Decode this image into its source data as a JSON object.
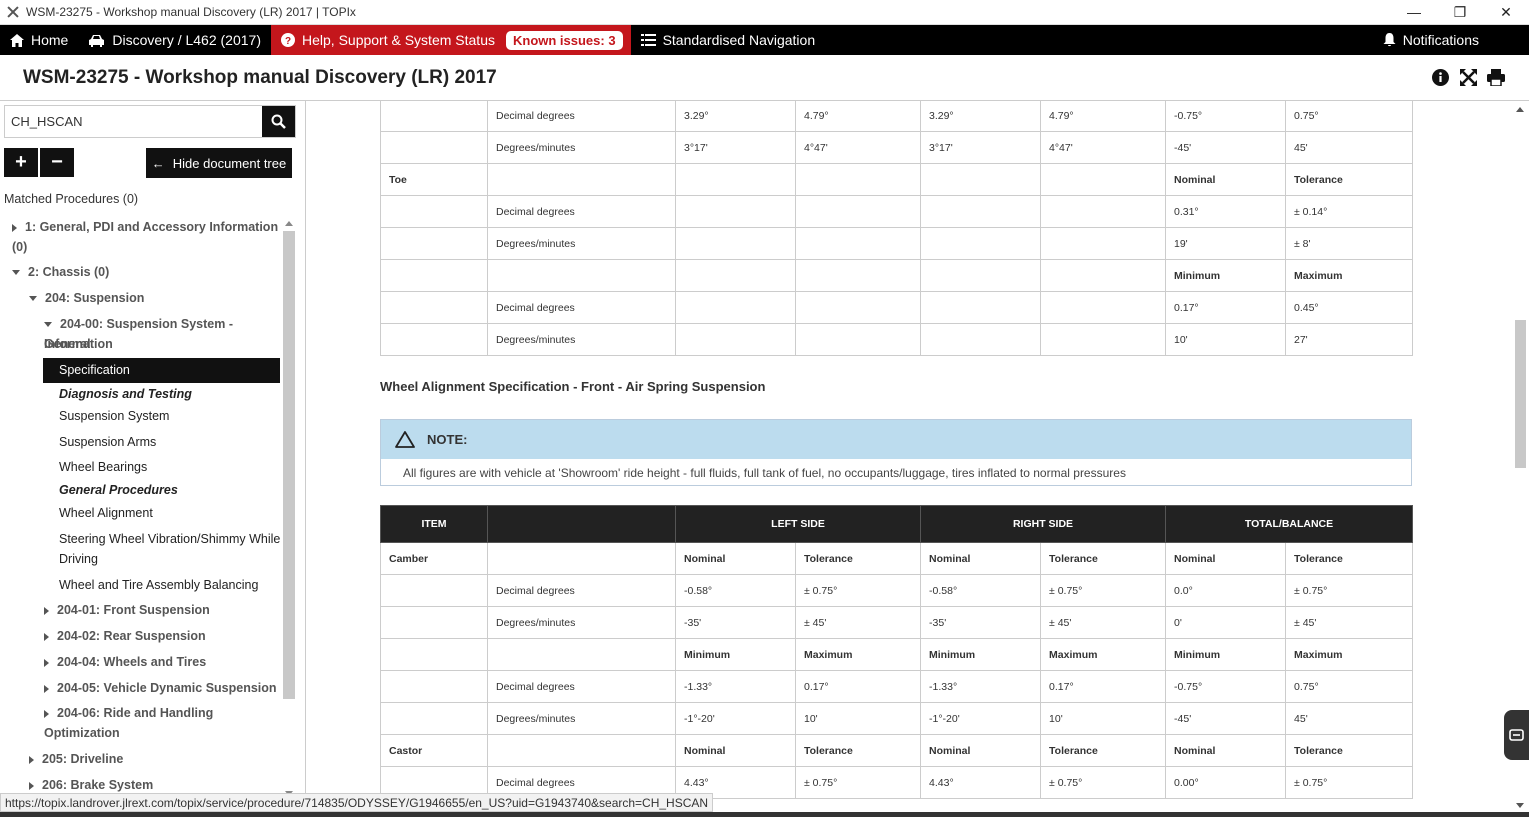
{
  "window": {
    "title": "WSM-23275 - Workshop manual Discovery (LR) 2017 | TOPIx",
    "minimize": "—",
    "maximize": "❐",
    "close": "✕"
  },
  "nav": {
    "home": "Home",
    "vehicle": "Discovery / L462 (2017)",
    "help": "Help, Support & System Status",
    "known_issues": "Known issues: 3",
    "standardised": "Standardised Navigation",
    "notifications": "Notifications"
  },
  "doc": {
    "title": "WSM-23275 - Workshop manual Discovery (LR) 2017"
  },
  "sidebar": {
    "search_value": "CH_HSCAN",
    "hide_tree": "Hide document tree",
    "matched": "Matched Procedures (0)",
    "tree": {
      "t1": "1: General, PDI and Accessory Information",
      "t1b": "(0)",
      "t2": "2: Chassis (0)",
      "t3": "204: Suspension",
      "t4a": "204-00: Suspension System - General",
      "t4b": "Information",
      "t5": "Specification",
      "t6": "Diagnosis and Testing",
      "t7": "Suspension System",
      "t8": "Suspension Arms",
      "t9": "Wheel Bearings",
      "t10": "General Procedures",
      "t11": "Wheel Alignment",
      "t12a": "Steering Wheel Vibration/Shimmy While",
      "t12b": "Driving",
      "t13": "Wheel and Tire Assembly Balancing",
      "t14": "204-01: Front Suspension",
      "t15": "204-02: Rear Suspension",
      "t16": "204-04: Wheels and Tires",
      "t17": "204-05: Vehicle Dynamic Suspension",
      "t18a": "204-06: Ride and Handling",
      "t18b": "Optimization",
      "t19": "205: Driveline",
      "t20": "206: Brake System"
    }
  },
  "table1": {
    "r1": [
      "",
      "Decimal degrees",
      "3.29°",
      "4.79°",
      "3.29°",
      "4.79°",
      "-0.75°",
      "0.75°"
    ],
    "r2": [
      "",
      "Degrees/minutes",
      "3°17'",
      "4°47'",
      "3°17'",
      "4°47'",
      "-45'",
      "45'"
    ],
    "r3": [
      "Toe",
      "",
      "",
      "",
      "",
      "",
      "Nominal",
      "Tolerance"
    ],
    "r4": [
      "",
      "Decimal degrees",
      "",
      "",
      "",
      "",
      "0.31°",
      "± 0.14°"
    ],
    "r5": [
      "",
      "Degrees/minutes",
      "",
      "",
      "",
      "",
      "19'",
      "± 8'"
    ],
    "r6": [
      "",
      "",
      "",
      "",
      "",
      "",
      "Minimum",
      "Maximum"
    ],
    "r7": [
      "",
      "Decimal degrees",
      "",
      "",
      "",
      "",
      "0.17°",
      "0.45°"
    ],
    "r8": [
      "",
      "Degrees/minutes",
      "",
      "",
      "",
      "",
      "10'",
      "27'"
    ]
  },
  "section_title": "Wheel Alignment Specification - Front - Air Spring Suspension",
  "note": {
    "label": "NOTE:",
    "text": "All figures are with vehicle at 'Showroom' ride height - full fluids, full tank of fuel, no occupants/luggage, tires inflated to normal pressures"
  },
  "table2": {
    "head": [
      "ITEM",
      "",
      "LEFT SIDE",
      "RIGHT SIDE",
      "TOTAL/BALANCE"
    ],
    "r1": [
      "Camber",
      "",
      "Nominal",
      "Tolerance",
      "Nominal",
      "Tolerance",
      "Nominal",
      "Tolerance"
    ],
    "r2": [
      "",
      "Decimal degrees",
      "-0.58°",
      "± 0.75°",
      "-0.58°",
      "± 0.75°",
      "0.0°",
      "± 0.75°"
    ],
    "r3": [
      "",
      "Degrees/minutes",
      "-35'",
      "± 45'",
      "-35'",
      "± 45'",
      "0'",
      "± 45'"
    ],
    "r4": [
      "",
      "",
      "Minimum",
      "Maximum",
      "Minimum",
      "Maximum",
      "Minimum",
      "Maximum"
    ],
    "r5": [
      "",
      "Decimal degrees",
      "-1.33°",
      "0.17°",
      "-1.33°",
      "0.17°",
      "-0.75°",
      "0.75°"
    ],
    "r6": [
      "",
      "Degrees/minutes",
      "-1°-20'",
      "10'",
      "-1°-20'",
      "10'",
      "-45'",
      "45'"
    ],
    "r7": [
      "Castor",
      "",
      "Nominal",
      "Tolerance",
      "Nominal",
      "Tolerance",
      "Nominal",
      "Tolerance"
    ],
    "r8": [
      "",
      "Decimal degrees",
      "4.43°",
      "± 0.75°",
      "4.43°",
      "± 0.75°",
      "0.00°",
      "± 0.75°"
    ]
  },
  "status_url": "https://topix.landrover.jlrext.com/topix/service/procedure/714835/ODYSSEY/G1946655/en_US?uid=G1943740&search=CH_HSCAN"
}
